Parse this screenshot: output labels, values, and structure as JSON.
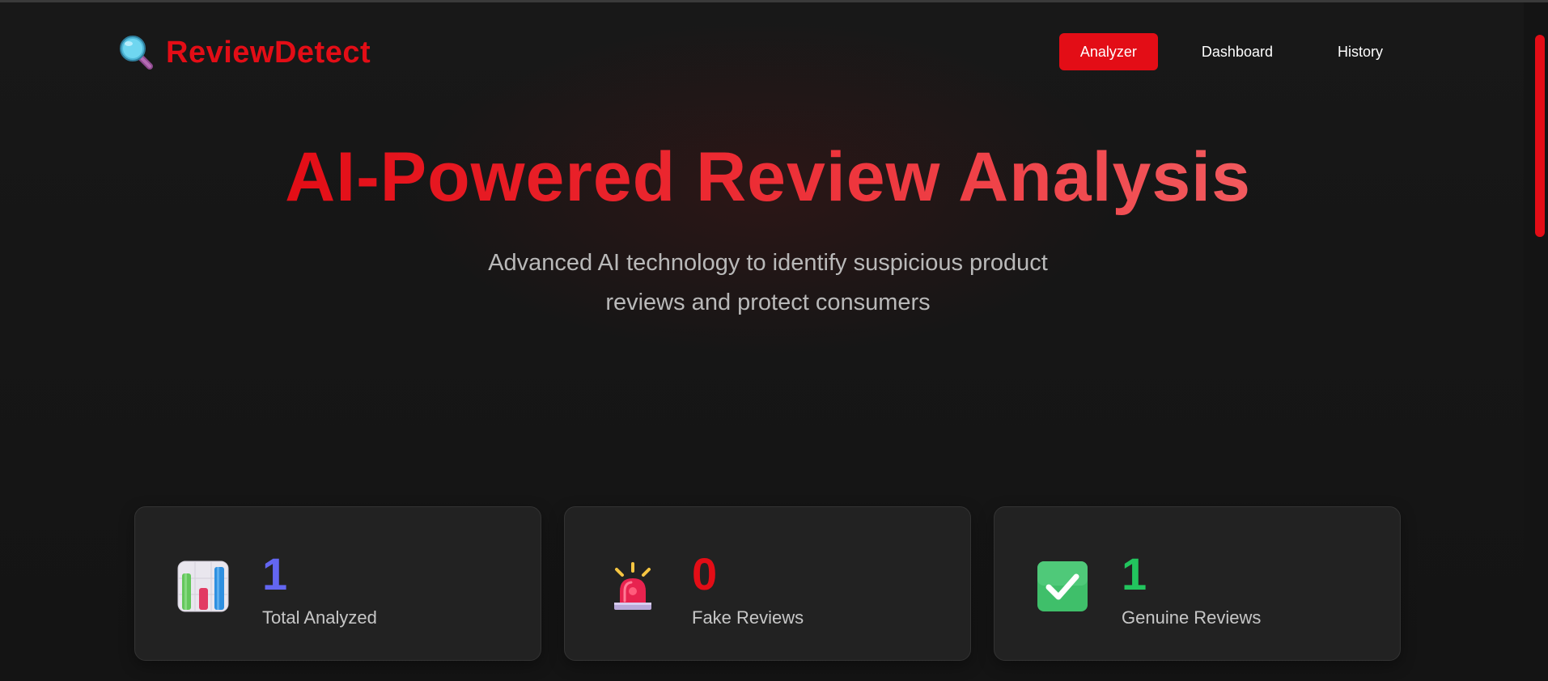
{
  "brand": {
    "name": "ReviewDetect",
    "icon": "magnifying-glass-icon",
    "color": "#e30d16"
  },
  "nav": {
    "items": [
      {
        "label": "Analyzer",
        "active": true
      },
      {
        "label": "Dashboard",
        "active": false
      },
      {
        "label": "History",
        "active": false
      }
    ]
  },
  "hero": {
    "title": "AI-Powered Review Analysis",
    "subtitle_line1": "Advanced AI technology to identify suspicious product",
    "subtitle_line2": "reviews and protect consumers"
  },
  "stats": [
    {
      "value": "1",
      "label": "Total Analyzed",
      "icon": "bar-chart-icon",
      "color": "#6366f1"
    },
    {
      "value": "0",
      "label": "Fake Reviews",
      "icon": "siren-icon",
      "color": "#e30d16"
    },
    {
      "value": "1",
      "label": "Genuine Reviews",
      "icon": "check-mark-icon",
      "color": "#22c55e"
    }
  ],
  "colors": {
    "accent": "#e30d16",
    "background": "#161616",
    "card": "#222222"
  }
}
